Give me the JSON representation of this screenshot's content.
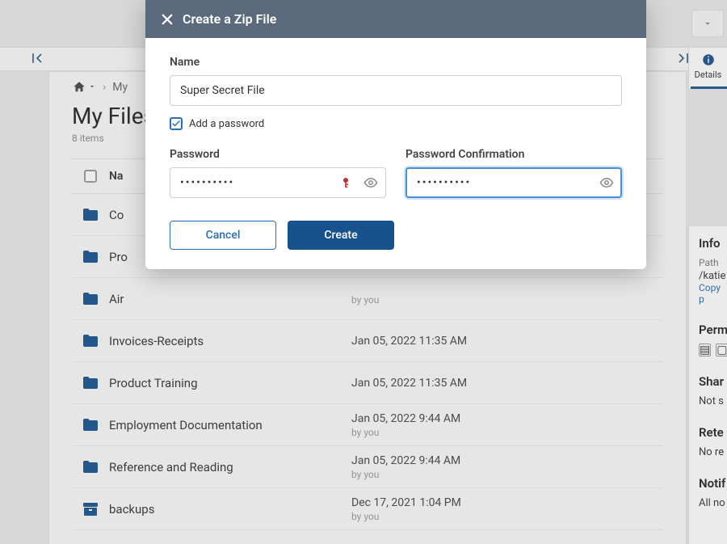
{
  "header": {
    "details_tab_label": "Details"
  },
  "breadcrumb": {
    "home_aria": "Home",
    "item2": "My"
  },
  "page": {
    "title": "My Files",
    "item_count": "8 items"
  },
  "list_header": {
    "name_label": "Na",
    "modified_label": ""
  },
  "rows": [
    {
      "name": "Co",
      "date": "",
      "by": "",
      "icon": "folder"
    },
    {
      "name": "Pro",
      "date": "",
      "by": "",
      "icon": "folder"
    },
    {
      "name": "Air",
      "date": "",
      "by": "by you",
      "icon": "folder"
    },
    {
      "name": "Invoices-Receipts",
      "date": "Jan 05, 2022 11:35 AM",
      "by": "",
      "icon": "folder"
    },
    {
      "name": "Product Training",
      "date": "Jan 05, 2022 11:35 AM",
      "by": "",
      "icon": "folder"
    },
    {
      "name": "Employment Documentation",
      "date": "Jan 05, 2022 9:44 AM",
      "by": "by you",
      "icon": "folder"
    },
    {
      "name": "Reference and Reading",
      "date": "Jan 05, 2022 9:44 AM",
      "by": "by you",
      "icon": "folder"
    },
    {
      "name": "backups",
      "date": "Dec 17, 2021 1:04 PM",
      "by": "by you",
      "icon": "archive"
    }
  ],
  "info_panel": {
    "section1_title": "Info",
    "path_label": "Path",
    "path_value": "/katie",
    "copy_label": "Copy p",
    "section2_title": "Perm",
    "section3_title": "Shar",
    "section3_value": "Not s",
    "section4_title": "Rete",
    "section4_value": "No re",
    "section5_title": "Notif",
    "section5_value": "All no"
  },
  "modal": {
    "title": "Create a Zip File",
    "name_label": "Name",
    "name_value": "Super Secret File",
    "add_password_label": "Add a password",
    "password_label": "Password",
    "password_value": "••••••••••",
    "confirm_label": "Password Confirmation",
    "confirm_value": "••••••••••",
    "cancel_label": "Cancel",
    "create_label": "Create"
  }
}
